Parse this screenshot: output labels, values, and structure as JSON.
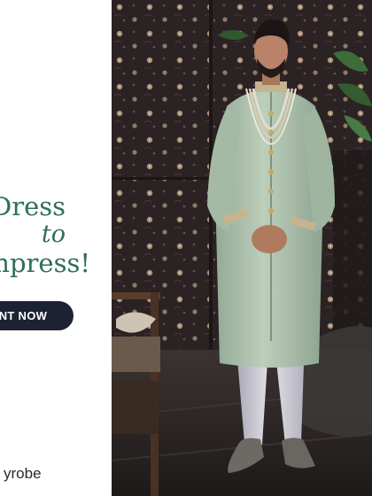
{
  "ad": {
    "headline": {
      "line1": "Dress",
      "line2": "to",
      "line3": "mpress!"
    },
    "cta_label": "ENT NOW",
    "brand": "yrobe"
  },
  "photo": {
    "description_icon": "model-photo",
    "colors": {
      "accent_green": "#2f6f57",
      "button_navy": "#1d2233",
      "sherwani_mint": "#b7cab4",
      "wall_dark": "#2a2425"
    }
  }
}
